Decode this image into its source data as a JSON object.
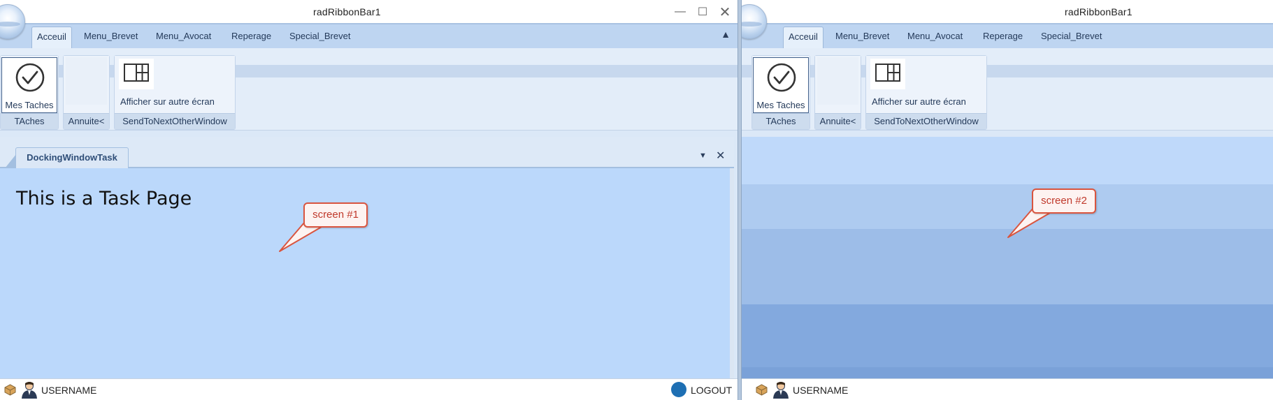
{
  "window": {
    "title": "radRibbonBar1",
    "minimize_icon": "minimize-icon",
    "maximize_icon": "maximize-icon",
    "close_icon": "close-icon"
  },
  "ribbon": {
    "tabs": [
      {
        "label": "Acceuil",
        "active": true
      },
      {
        "label": "Menu_Brevet"
      },
      {
        "label": "Menu_Avocat"
      },
      {
        "label": "Reperage"
      },
      {
        "label": "Special_Brevet"
      }
    ],
    "groups": {
      "taches": {
        "button_label": "Mes Taches",
        "footer": "TAches",
        "icon": "check-circle-icon"
      },
      "annuite": {
        "footer": "Annuite<"
      },
      "send": {
        "button_label": "Afficher sur autre écran",
        "footer": "SendToNextOtherWindow",
        "icon": "grid-layout-icon"
      }
    }
  },
  "dock": {
    "tab_label": "DockingWindowTask",
    "content_text": "This is a Task Page"
  },
  "callouts": {
    "screen1": "screen #1",
    "screen2": "screen #2"
  },
  "status": {
    "username": "USERNAME",
    "logout": "LOGOUT"
  },
  "colors": {
    "ribbon_tab_bar": "#bed5f1",
    "dock_body": "#bbd8fb",
    "callout_border": "#d9553f",
    "logout_accent": "#1e6fb3"
  }
}
